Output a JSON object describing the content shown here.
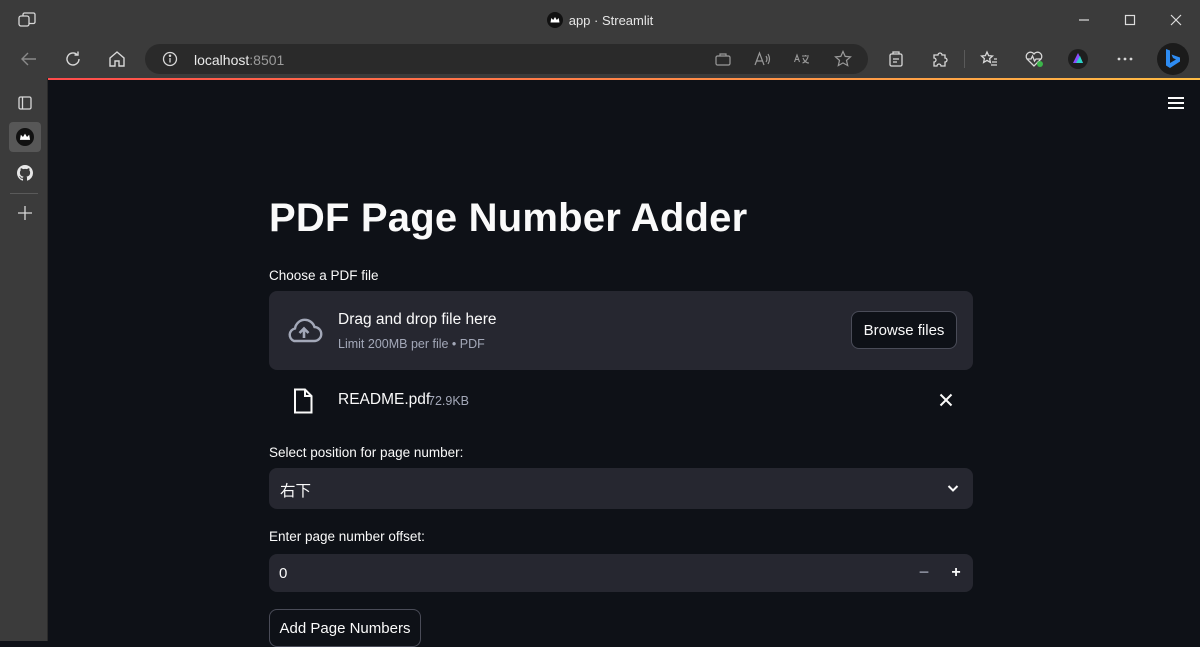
{
  "browser": {
    "tab_title": "app · Streamlit",
    "url_host": "localhost",
    "url_port": ":8501"
  },
  "app": {
    "title": "PDF Page Number Adder",
    "uploader": {
      "label": "Choose a PDF file",
      "drop_text": "Drag and drop file here",
      "limit_text": "Limit 200MB per file • PDF",
      "browse_label": "Browse files"
    },
    "uploaded_file": {
      "name": "README.pdf",
      "size": "72.9KB"
    },
    "position_select": {
      "label": "Select position for page number:",
      "value": "右下"
    },
    "offset_input": {
      "label": "Enter page number offset:",
      "value": "0",
      "minus": "−",
      "plus": "+"
    },
    "submit_label": "Add Page Numbers"
  },
  "colors": {
    "background": "#0e1117",
    "widget": "#262730",
    "browser_chrome": "#3b3b3b",
    "accent_gradient_start": "#ff4b4b",
    "accent_gradient_end": "#ffbd45"
  }
}
